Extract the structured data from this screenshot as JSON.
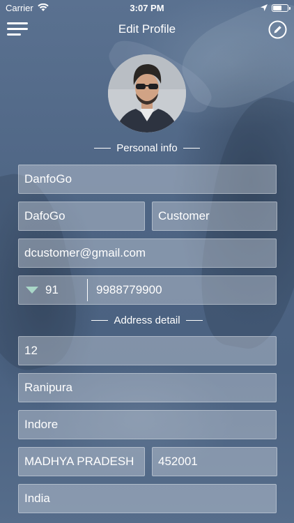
{
  "status_bar": {
    "carrier": "Carrier",
    "time": "3:07 PM",
    "battery_level": 0.6
  },
  "nav": {
    "title": "Edit Profile",
    "menu_icon": "hamburger-menu-icon",
    "edit_icon": "pencil-edit-icon"
  },
  "sections": {
    "personal_info": "Personal info",
    "address_detail": "Address detail"
  },
  "personal": {
    "display_name": "DanfoGo",
    "first_name": "DafoGo",
    "role": "Customer",
    "email": "dcustomer@gmail.com",
    "country_code": "91",
    "phone": "9988779900"
  },
  "address": {
    "house_no": "12",
    "area": "Ranipura",
    "city": "Indore",
    "state": "MADHYA PRADESH",
    "pincode": "452001",
    "country": "India"
  },
  "colors": {
    "background": "#526a86",
    "field_fill": "rgba(220,226,234,0.38)",
    "dropdown_arrow": "#a9d7c8",
    "text": "#ffffff"
  }
}
